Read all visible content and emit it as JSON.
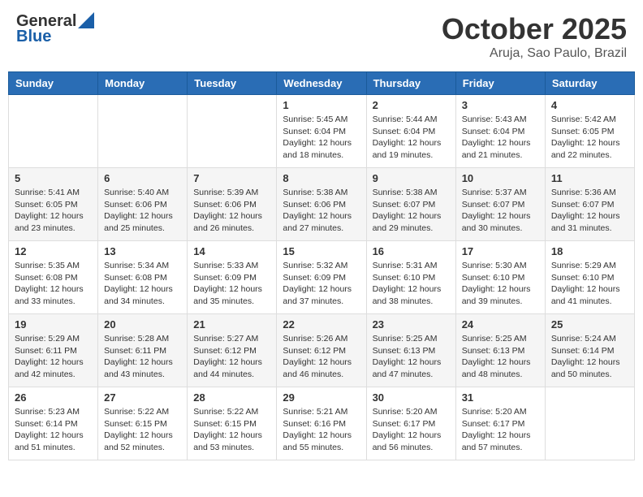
{
  "header": {
    "logo_general": "General",
    "logo_blue": "Blue",
    "month": "October 2025",
    "location": "Aruja, Sao Paulo, Brazil"
  },
  "weekdays": [
    "Sunday",
    "Monday",
    "Tuesday",
    "Wednesday",
    "Thursday",
    "Friday",
    "Saturday"
  ],
  "weeks": [
    [
      {
        "day": "",
        "content": ""
      },
      {
        "day": "",
        "content": ""
      },
      {
        "day": "",
        "content": ""
      },
      {
        "day": "1",
        "content": "Sunrise: 5:45 AM\nSunset: 6:04 PM\nDaylight: 12 hours and 18 minutes."
      },
      {
        "day": "2",
        "content": "Sunrise: 5:44 AM\nSunset: 6:04 PM\nDaylight: 12 hours and 19 minutes."
      },
      {
        "day": "3",
        "content": "Sunrise: 5:43 AM\nSunset: 6:04 PM\nDaylight: 12 hours and 21 minutes."
      },
      {
        "day": "4",
        "content": "Sunrise: 5:42 AM\nSunset: 6:05 PM\nDaylight: 12 hours and 22 minutes."
      }
    ],
    [
      {
        "day": "5",
        "content": "Sunrise: 5:41 AM\nSunset: 6:05 PM\nDaylight: 12 hours and 23 minutes."
      },
      {
        "day": "6",
        "content": "Sunrise: 5:40 AM\nSunset: 6:06 PM\nDaylight: 12 hours and 25 minutes."
      },
      {
        "day": "7",
        "content": "Sunrise: 5:39 AM\nSunset: 6:06 PM\nDaylight: 12 hours and 26 minutes."
      },
      {
        "day": "8",
        "content": "Sunrise: 5:38 AM\nSunset: 6:06 PM\nDaylight: 12 hours and 27 minutes."
      },
      {
        "day": "9",
        "content": "Sunrise: 5:38 AM\nSunset: 6:07 PM\nDaylight: 12 hours and 29 minutes."
      },
      {
        "day": "10",
        "content": "Sunrise: 5:37 AM\nSunset: 6:07 PM\nDaylight: 12 hours and 30 minutes."
      },
      {
        "day": "11",
        "content": "Sunrise: 5:36 AM\nSunset: 6:07 PM\nDaylight: 12 hours and 31 minutes."
      }
    ],
    [
      {
        "day": "12",
        "content": "Sunrise: 5:35 AM\nSunset: 6:08 PM\nDaylight: 12 hours and 33 minutes."
      },
      {
        "day": "13",
        "content": "Sunrise: 5:34 AM\nSunset: 6:08 PM\nDaylight: 12 hours and 34 minutes."
      },
      {
        "day": "14",
        "content": "Sunrise: 5:33 AM\nSunset: 6:09 PM\nDaylight: 12 hours and 35 minutes."
      },
      {
        "day": "15",
        "content": "Sunrise: 5:32 AM\nSunset: 6:09 PM\nDaylight: 12 hours and 37 minutes."
      },
      {
        "day": "16",
        "content": "Sunrise: 5:31 AM\nSunset: 6:10 PM\nDaylight: 12 hours and 38 minutes."
      },
      {
        "day": "17",
        "content": "Sunrise: 5:30 AM\nSunset: 6:10 PM\nDaylight: 12 hours and 39 minutes."
      },
      {
        "day": "18",
        "content": "Sunrise: 5:29 AM\nSunset: 6:10 PM\nDaylight: 12 hours and 41 minutes."
      }
    ],
    [
      {
        "day": "19",
        "content": "Sunrise: 5:29 AM\nSunset: 6:11 PM\nDaylight: 12 hours and 42 minutes."
      },
      {
        "day": "20",
        "content": "Sunrise: 5:28 AM\nSunset: 6:11 PM\nDaylight: 12 hours and 43 minutes."
      },
      {
        "day": "21",
        "content": "Sunrise: 5:27 AM\nSunset: 6:12 PM\nDaylight: 12 hours and 44 minutes."
      },
      {
        "day": "22",
        "content": "Sunrise: 5:26 AM\nSunset: 6:12 PM\nDaylight: 12 hours and 46 minutes."
      },
      {
        "day": "23",
        "content": "Sunrise: 5:25 AM\nSunset: 6:13 PM\nDaylight: 12 hours and 47 minutes."
      },
      {
        "day": "24",
        "content": "Sunrise: 5:25 AM\nSunset: 6:13 PM\nDaylight: 12 hours and 48 minutes."
      },
      {
        "day": "25",
        "content": "Sunrise: 5:24 AM\nSunset: 6:14 PM\nDaylight: 12 hours and 50 minutes."
      }
    ],
    [
      {
        "day": "26",
        "content": "Sunrise: 5:23 AM\nSunset: 6:14 PM\nDaylight: 12 hours and 51 minutes."
      },
      {
        "day": "27",
        "content": "Sunrise: 5:22 AM\nSunset: 6:15 PM\nDaylight: 12 hours and 52 minutes."
      },
      {
        "day": "28",
        "content": "Sunrise: 5:22 AM\nSunset: 6:15 PM\nDaylight: 12 hours and 53 minutes."
      },
      {
        "day": "29",
        "content": "Sunrise: 5:21 AM\nSunset: 6:16 PM\nDaylight: 12 hours and 55 minutes."
      },
      {
        "day": "30",
        "content": "Sunrise: 5:20 AM\nSunset: 6:17 PM\nDaylight: 12 hours and 56 minutes."
      },
      {
        "day": "31",
        "content": "Sunrise: 5:20 AM\nSunset: 6:17 PM\nDaylight: 12 hours and 57 minutes."
      },
      {
        "day": "",
        "content": ""
      }
    ]
  ]
}
